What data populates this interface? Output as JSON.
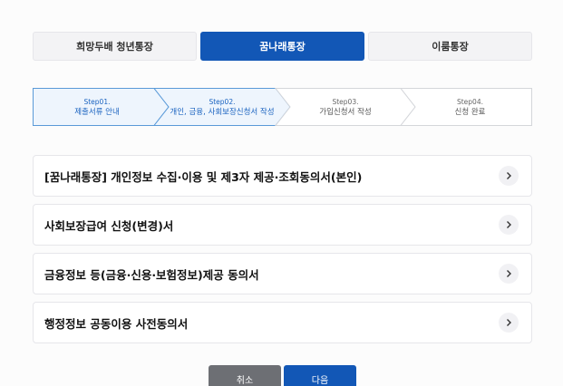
{
  "tabs": [
    {
      "label": "희망두배 청년통장",
      "active": false
    },
    {
      "label": "꿈나래통장",
      "active": true
    },
    {
      "label": "이룸통장",
      "active": false
    }
  ],
  "steps": [
    {
      "num": "Step01.",
      "label": "제출서류 안내",
      "state": "done"
    },
    {
      "num": "Step02.",
      "label": "개인, 금융, 사회보장신청서 작성",
      "state": "current"
    },
    {
      "num": "Step03.",
      "label": "가입신청서 작성",
      "state": "todo"
    },
    {
      "num": "Step04.",
      "label": "신청 완료",
      "state": "todo"
    }
  ],
  "agreements": [
    {
      "title": "[꿈나래통장] 개인정보 수집·이용 및 제3자 제공·조회동의서(본인)"
    },
    {
      "title": "사회보장급여 신청(변경)서"
    },
    {
      "title": "금융정보 등(금융·신용·보험정보)제공 동의서"
    },
    {
      "title": "행정정보 공동이용 사전동의서"
    }
  ],
  "buttons": {
    "cancel_label": "취소",
    "next_label": "다음"
  },
  "colors": {
    "primary": "#1257b6",
    "step_done_bg": "#eef5fd",
    "step_done_text": "#1a63c0",
    "cancel_bg": "#6d6f74"
  }
}
